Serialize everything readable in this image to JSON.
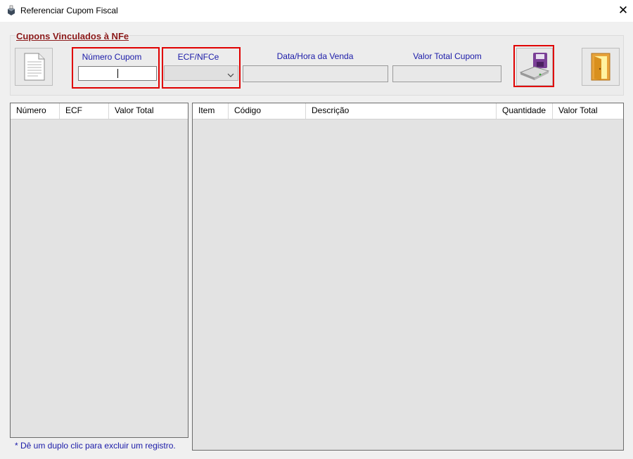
{
  "window": {
    "title": "Referenciar Cupom Fiscal",
    "close_glyph": "✕",
    "icon": "printer-icon"
  },
  "group": {
    "title": "Cupons Vinculados à NFe"
  },
  "fields": {
    "numero_cupom": {
      "label": "Número Cupom",
      "value": ""
    },
    "ecf_nfce": {
      "label": "ECF/NFCe",
      "value": ""
    },
    "data_hora": {
      "label": "Data/Hora da Venda",
      "value": ""
    },
    "valor_total": {
      "label": "Valor Total Cupom",
      "value": ""
    }
  },
  "buttons": {
    "new": {
      "icon": "document-icon"
    },
    "save": {
      "icon": "floppy-disk-icon"
    },
    "exit": {
      "icon": "door-exit-icon"
    }
  },
  "left_grid": {
    "columns": [
      "Número",
      "ECF",
      "Valor Total"
    ],
    "rows": []
  },
  "right_grid": {
    "columns": [
      "Item",
      "Código",
      "Descrição",
      "Quantidade",
      "Valor Total"
    ],
    "rows": []
  },
  "hint": "* Dê um duplo clic para excluir um registro.",
  "colors": {
    "label_blue": "#1a1aa8",
    "title_red": "#8b1a1a",
    "highlight_red": "#e00000"
  }
}
